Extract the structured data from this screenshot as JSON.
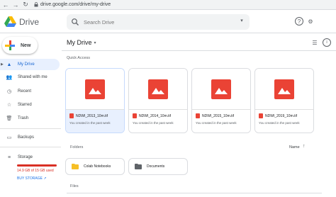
{
  "browser": {
    "back": "←",
    "forward": "→",
    "reload": "↻",
    "url": "drive.google.com/drive/my-drive"
  },
  "header": {
    "brand": "Drive",
    "search_placeholder": "Search Drive",
    "help_icon": "?",
    "settings_icon": "⚙",
    "colors": {
      "accent": "#1a73e8",
      "logo_green": "#34a853",
      "logo_yellow": "#fbbc04",
      "logo_blue": "#4285f4"
    }
  },
  "sidebar": {
    "new_label": "New",
    "items": [
      {
        "label": "My Drive",
        "icon": "drive-icon",
        "active": true
      },
      {
        "label": "Shared with me",
        "icon": "people-icon",
        "active": false
      },
      {
        "label": "Recent",
        "icon": "clock-icon",
        "active": false
      },
      {
        "label": "Starred",
        "icon": "star-icon",
        "active": false
      },
      {
        "label": "Trash",
        "icon": "trash-icon",
        "active": false
      },
      {
        "label": "Backups",
        "icon": "backup-icon",
        "active": false
      },
      {
        "label": "Storage",
        "icon": "storage-icon",
        "active": false
      }
    ],
    "storage_text": "14.9 GB of 15 GB used",
    "storage_fraction": 0.993,
    "buy_storage": "BUY STORAGE"
  },
  "main": {
    "title": "My Drive",
    "title_caret": "▾",
    "quick_access_label": "Quick Access",
    "quick_access": [
      {
        "name": "NDWI_2013_10m.tif",
        "subtitle": "You created in the past week",
        "selected": true
      },
      {
        "name": "NDWI_2014_10m.tif",
        "subtitle": "You created in the past week",
        "selected": false
      },
      {
        "name": "NDWI_2015_10m.tif",
        "subtitle": "You created in the past week",
        "selected": false
      },
      {
        "name": "NDWI_2019_10m.tif",
        "subtitle": "You created in the past week",
        "selected": false
      }
    ],
    "folders_label": "Folders",
    "sort_label": "Name",
    "sort_arrow": "↑",
    "folders": [
      {
        "name": "Colab Notebooks",
        "color": "#f6bf26"
      },
      {
        "name": "Documents",
        "color": "#5f6368"
      }
    ],
    "files_label": "Files",
    "file_icon_color": "#ea4335"
  }
}
